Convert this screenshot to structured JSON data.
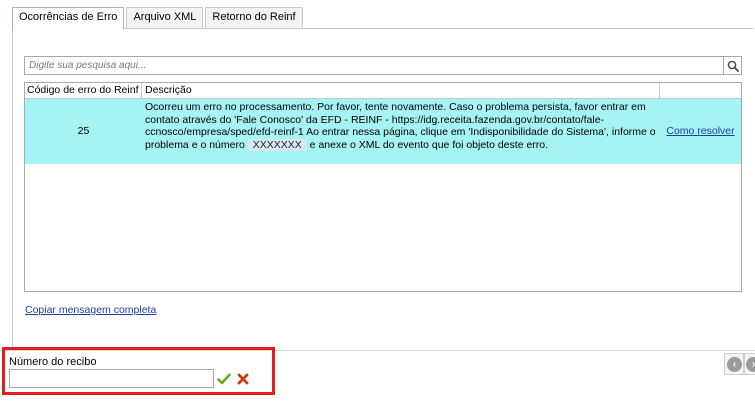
{
  "tabs": [
    {
      "label": "Ocorrências de Erro",
      "active": true
    },
    {
      "label": "Arquivo XML",
      "active": false
    },
    {
      "label": "Retorno do Reinf",
      "active": false
    }
  ],
  "search": {
    "placeholder": "Digite sua pesquisa aqui...",
    "icon": "search-icon"
  },
  "grid": {
    "columns": [
      "Código de erro do Reinf",
      "Descrição",
      ""
    ],
    "rows": [
      {
        "code": "25",
        "description_before": "Ocorreu um erro no processamento. Por favor, tente novamente. Caso o problema persista, favor entrar em contato através do 'Fale Conosco' da EFD - REINF - https://idg.receita.fazenda.gov.br/contato/fale-ccnosco/empresa/sped/efd-reinf-1 Ao entrar nessa página, clique em 'Indisponibilidade do Sistema', informe o problema e o número ",
        "description_masked": "XXXXXXX",
        "description_after": " e anexe o XML do evento que foi objeto deste erro.",
        "action_label": "Como resolver",
        "highlight_color": "#a5f3f3"
      }
    ]
  },
  "copy_link": "Copiar mensagem completa",
  "recibo": {
    "label": "Número do recibo",
    "value": ""
  },
  "colors": {
    "tab_active_border": "#9bb9d6",
    "highlight_box": "#e21d1d",
    "link": "#1a3fa6"
  }
}
